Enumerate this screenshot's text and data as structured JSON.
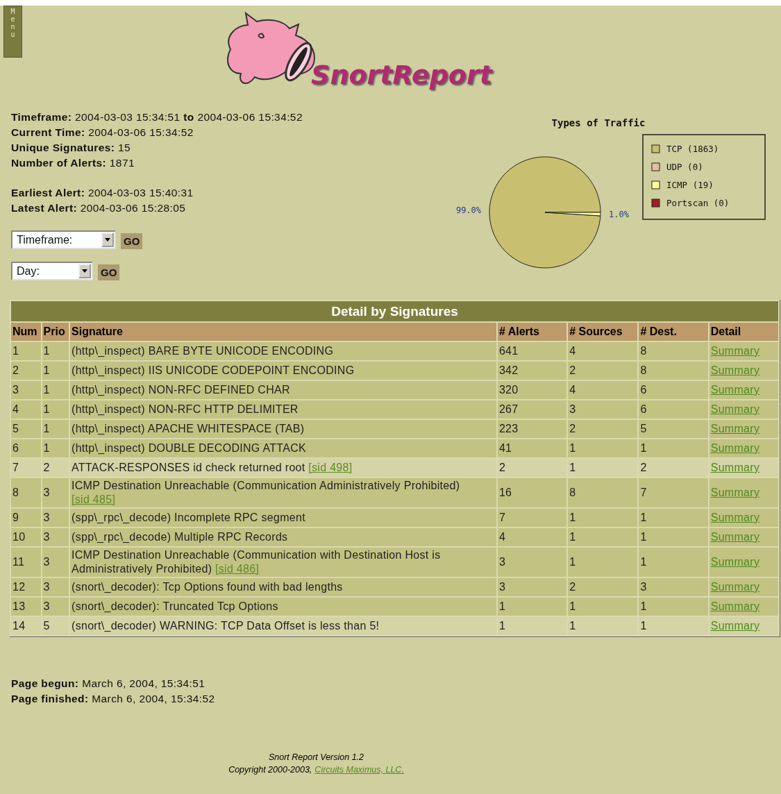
{
  "menu_tab": {
    "label": "Menu"
  },
  "logo": {
    "text": "SnortReport"
  },
  "summary": {
    "groups": [
      [
        "**Timeframe:** 2004-03-03 15:34:51 **to** 2004-03-06 15:34:52",
        "**Current Time:** 2004-03-06 15:34:52",
        "**Unique Signatures:** 15",
        "**Number of Alerts:** 1871"
      ],
      [
        "**Earliest Alert:** 2004-03-03 15:40:31",
        "**Latest Alert:** 2004-03-06 15:28:05"
      ]
    ]
  },
  "filters": [
    {
      "value": "Timeframe:",
      "button": "GO"
    },
    {
      "value": "Day:",
      "button": "GO"
    }
  ],
  "traffic_chart": {
    "chart_data": {
      "type": "pie",
      "title": "Types of Traffic",
      "categories": [
        "TCP (1863)",
        "UDP (0)",
        "ICMP (19)",
        "Portscan (0)"
      ],
      "values": [
        99.0,
        0,
        1.0,
        0
      ],
      "colors": [
        "#c8c070",
        "#e6c0a0",
        "#ffff99",
        "#a02020"
      ],
      "value_labels": [
        "99.0%",
        null,
        "1.0%",
        null
      ],
      "legend": "right"
    }
  },
  "table": {
    "title": "Detail by Signatures",
    "columns": [
      "Num",
      "Prio",
      "Signature",
      "# Alerts",
      "# Sources",
      "# Dest.",
      "Detail"
    ],
    "rows": [
      {
        "num": "1",
        "prio": "1",
        "signature": "(http\\_inspect) BARE BYTE UNICODE ENCODING",
        "alerts": "641",
        "sources": "4",
        "dest": "8",
        "detail": "Summary",
        "color": "#c2c283"
      },
      {
        "num": "2",
        "prio": "1",
        "signature": "(http\\_inspect) IIS UNICODE CODEPOINT ENCODING",
        "alerts": "342",
        "sources": "2",
        "dest": "8",
        "detail": "Summary",
        "color": "#c2c283"
      },
      {
        "num": "3",
        "prio": "1",
        "signature": "(http\\_inspect) NON-RFC DEFINED CHAR",
        "alerts": "320",
        "sources": "4",
        "dest": "6",
        "detail": "Summary",
        "color": "#c2c283"
      },
      {
        "num": "4",
        "prio": "1",
        "signature": "(http\\_inspect) NON-RFC HTTP DELIMITER",
        "alerts": "267",
        "sources": "3",
        "dest": "6",
        "detail": "Summary",
        "color": "#c2c283"
      },
      {
        "num": "5",
        "prio": "1",
        "signature": "(http\\_inspect) APACHE WHITESPACE (TAB)",
        "alerts": "223",
        "sources": "2",
        "dest": "5",
        "detail": "Summary",
        "color": "#c2c283"
      },
      {
        "num": "6",
        "prio": "1",
        "signature": "(http\\_inspect) DOUBLE DECODING ATTACK",
        "alerts": "41",
        "sources": "1",
        "dest": "1",
        "detail": "Summary",
        "color": "#c2c283"
      },
      {
        "num": "7",
        "prio": "2",
        "signature": {
          "text": "ATTACK-RESPONSES id check returned root",
          "link": "[sid 498]"
        },
        "alerts": "2",
        "sources": "1",
        "dest": "2",
        "detail": "Summary",
        "color": "#d4d4a6"
      },
      {
        "num": "8",
        "prio": "3",
        "signature": {
          "text": "ICMP Destination Unreachable (Communication Administratively Prohibited)",
          "link": "[sid 485]"
        },
        "alerts": "16",
        "sources": "8",
        "dest": "7",
        "detail": "Summary",
        "color": "#c2c283"
      },
      {
        "num": "9",
        "prio": "3",
        "signature": "(spp\\_rpc\\_decode) Incomplete RPC segment",
        "alerts": "7",
        "sources": "1",
        "dest": "1",
        "detail": "Summary",
        "color": "#c2c283"
      },
      {
        "num": "10",
        "prio": "3",
        "signature": "(spp\\_rpc\\_decode) Multiple RPC Records",
        "alerts": "4",
        "sources": "1",
        "dest": "1",
        "detail": "Summary",
        "color": "#c2c283"
      },
      {
        "num": "11",
        "prio": "3",
        "signature": {
          "text": "ICMP Destination Unreachable (Communication with Destination Host is Administratively Prohibited)",
          "link": "[sid 486]"
        },
        "alerts": "3",
        "sources": "1",
        "dest": "1",
        "detail": "Summary",
        "color": "#c2c283"
      },
      {
        "num": "12",
        "prio": "3",
        "signature": "(snort\\_decoder): Tcp Options found with bad lengths",
        "alerts": "3",
        "sources": "2",
        "dest": "3",
        "detail": "Summary",
        "color": "#c2c283"
      },
      {
        "num": "13",
        "prio": "3",
        "signature": "(snort\\_decoder): Truncated Tcp Options",
        "alerts": "1",
        "sources": "1",
        "dest": "1",
        "detail": "Summary",
        "color": "#c2c283"
      },
      {
        "num": "14",
        "prio": "5",
        "signature": "(snort\\_decoder) WARNING: TCP Data Offset is less than 5!",
        "alerts": "1",
        "sources": "1",
        "dest": "1",
        "detail": "Summary",
        "color": "#d4d4a6"
      }
    ]
  },
  "timing": [
    "**Page begun:** March 6, 2004, 15:34:51",
    "**Page finished:** March 6, 2004, 15:34:52"
  ],
  "footer": {
    "version": "Snort Report Version 1.2",
    "copyright": "Copyright 2000-2003,",
    "link": "Circuits Maximus, LLC."
  }
}
